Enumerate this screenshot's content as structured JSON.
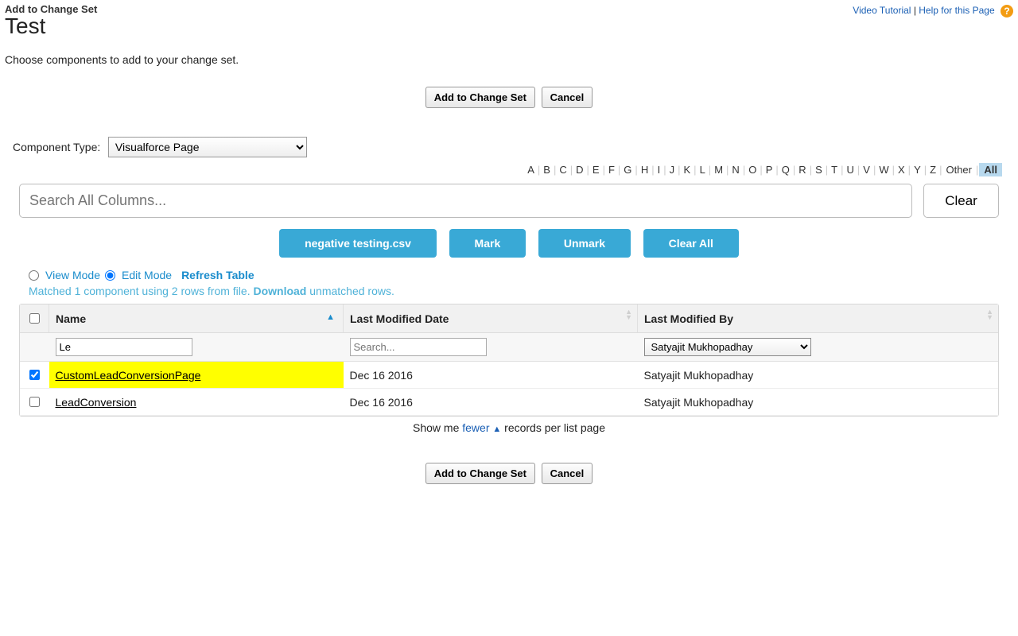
{
  "header": {
    "subtitle": "Add to Change Set",
    "title": "Test",
    "links": {
      "video": "Video Tutorial",
      "help": "Help for this Page"
    }
  },
  "description": "Choose components to add to your change set.",
  "buttons": {
    "add": "Add to Change Set",
    "cancel": "Cancel",
    "clear": "Clear",
    "mark": "Mark",
    "unmark": "Unmark",
    "clear_all": "Clear All",
    "file": "negative testing.csv"
  },
  "component_type": {
    "label": "Component Type:",
    "value": "Visualforce Page"
  },
  "alpha": {
    "letters": [
      "A",
      "B",
      "C",
      "D",
      "E",
      "F",
      "G",
      "H",
      "I",
      "J",
      "K",
      "L",
      "M",
      "N",
      "O",
      "P",
      "Q",
      "R",
      "S",
      "T",
      "U",
      "V",
      "W",
      "X",
      "Y",
      "Z"
    ],
    "other": "Other",
    "all": "All",
    "selected": "All"
  },
  "search": {
    "placeholder": "Search All Columns..."
  },
  "mode": {
    "view": "View Mode",
    "edit": "Edit Mode",
    "refresh": "Refresh Table",
    "selected": "edit"
  },
  "match_message": {
    "pre": "Matched 1 component using 2 rows from file. ",
    "download": "Download",
    "post": " unmatched rows."
  },
  "table": {
    "columns": {
      "name": "Name",
      "date": "Last Modified Date",
      "by": "Last Modified By"
    },
    "filters": {
      "name_value": "Le",
      "date_placeholder": "Search...",
      "by_value": "Satyajit Mukhopadhay"
    },
    "rows": [
      {
        "checked": true,
        "highlight": true,
        "name": "CustomLeadConversionPage",
        "date": "Dec 16 2016",
        "by": "Satyajit Mukhopadhay"
      },
      {
        "checked": false,
        "highlight": false,
        "name": "LeadConversion",
        "date": "Dec 16 2016",
        "by": "Satyajit Mukhopadhay"
      }
    ]
  },
  "pager": {
    "pre": "Show me ",
    "fewer": "fewer",
    "post": " records per list page"
  }
}
